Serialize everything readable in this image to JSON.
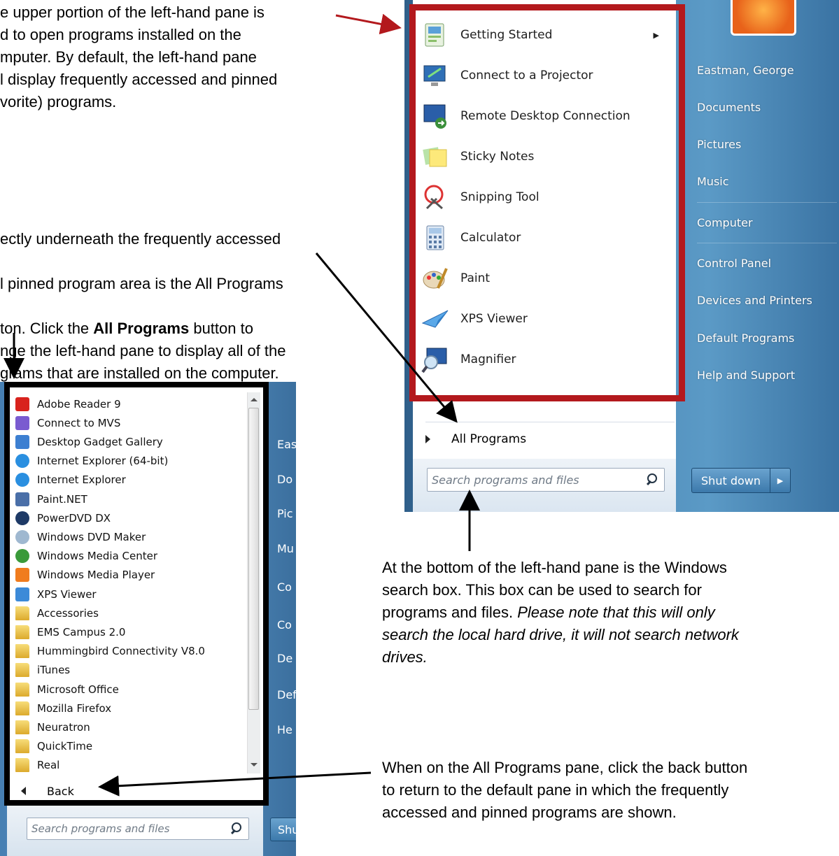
{
  "annotations": {
    "top_left": "e upper portion of the left-hand pane is\nd to open programs installed on the\nmputer.  By default, the left-hand pane\nl display frequently accessed and pinned\nvorite) programs.",
    "middle_left_lines": [
      "ectly underneath the frequently accessed",
      "l pinned program area is the All Programs",
      "ton.  Click the "
    ],
    "middle_bold": "All Programs",
    "middle_rest": " button to\nnge the left-hand pane to display all of the\ngrams that are installed on the computer.",
    "search_note_plain": "At the bottom of the left-hand pane is the Windows\nsearch box.  This box can be used to search for\nprograms and files.  ",
    "search_note_italic": "Please note that this will only\nsearch the local hard drive, it will not search network\ndrives.",
    "back_note": "When on the All Programs pane, click the back button\nto return to the default pane in which the frequently\naccessed and pinned programs are shown."
  },
  "start_menu": {
    "pinned": [
      {
        "label": "Getting Started",
        "icon": "getting-started-icon",
        "has_submenu": true
      },
      {
        "label": "Connect to a Projector",
        "icon": "projector-icon"
      },
      {
        "label": "Remote Desktop Connection",
        "icon": "remote-desktop-icon"
      },
      {
        "label": "Sticky Notes",
        "icon": "sticky-notes-icon"
      },
      {
        "label": "Snipping Tool",
        "icon": "snipping-tool-icon"
      },
      {
        "label": "Calculator",
        "icon": "calculator-icon"
      },
      {
        "label": "Paint",
        "icon": "paint-icon"
      },
      {
        "label": "XPS Viewer",
        "icon": "xps-viewer-icon"
      },
      {
        "label": "Magnifier",
        "icon": "magnifier-icon"
      }
    ],
    "all_programs_label": "All Programs",
    "search_placeholder": "Search programs and files",
    "right_links": [
      "Eastman, George",
      "Documents",
      "Pictures",
      "Music",
      "Computer",
      "Control Panel",
      "Devices and Printers",
      "Default Programs",
      "Help and Support"
    ],
    "shutdown_label": "Shut down"
  },
  "all_programs_menu": {
    "items": [
      {
        "label": "Adobe Reader 9",
        "icon": "adobe-reader-icon",
        "color": "#d8231d"
      },
      {
        "label": "Connect to MVS",
        "icon": "connect-mvs-icon",
        "color": "#7a5bd0"
      },
      {
        "label": "Desktop Gadget Gallery",
        "icon": "gadget-gallery-icon",
        "color": "#3d7fd1"
      },
      {
        "label": "Internet Explorer (64-bit)",
        "icon": "internet-explorer-icon",
        "color": "#2a8fe0"
      },
      {
        "label": "Internet Explorer",
        "icon": "internet-explorer-icon",
        "color": "#2a8fe0"
      },
      {
        "label": "Paint.NET",
        "icon": "paint-net-icon",
        "color": "#4a6fa8"
      },
      {
        "label": "PowerDVD DX",
        "icon": "powerdvd-icon",
        "color": "#1e3a66"
      },
      {
        "label": "Windows DVD Maker",
        "icon": "dvd-maker-icon",
        "color": "#9fb8d0"
      },
      {
        "label": "Windows Media Center",
        "icon": "media-center-icon",
        "color": "#3a9a3a"
      },
      {
        "label": "Windows Media Player",
        "icon": "media-player-icon",
        "color": "#f07c1e"
      },
      {
        "label": "XPS Viewer",
        "icon": "xps-viewer-icon",
        "color": "#3c8ad8"
      },
      {
        "label": "Accessories",
        "icon": "folder-icon",
        "folder": true
      },
      {
        "label": "EMS Campus 2.0",
        "icon": "folder-icon",
        "folder": true
      },
      {
        "label": "Hummingbird Connectivity V8.0",
        "icon": "folder-icon",
        "folder": true
      },
      {
        "label": "iTunes",
        "icon": "folder-icon",
        "folder": true
      },
      {
        "label": "Microsoft Office",
        "icon": "folder-icon",
        "folder": true
      },
      {
        "label": "Mozilla Firefox",
        "icon": "folder-icon",
        "folder": true
      },
      {
        "label": "Neuratron",
        "icon": "folder-icon",
        "folder": true
      },
      {
        "label": "QuickTime",
        "icon": "folder-icon",
        "folder": true
      },
      {
        "label": "Real",
        "icon": "folder-icon",
        "folder": true
      }
    ],
    "back_label": "Back",
    "search_placeholder": "Search programs and files",
    "right_links_partial": [
      "Eas",
      "Do",
      "Pic",
      "Mu",
      "Co",
      "Co",
      "De",
      "Def",
      "He"
    ],
    "shutdown_partial": "Shu"
  },
  "colors": {
    "highlight_box": "#b3191d",
    "black_box": "#000000",
    "callout_arrow_red": "#b3191d"
  }
}
